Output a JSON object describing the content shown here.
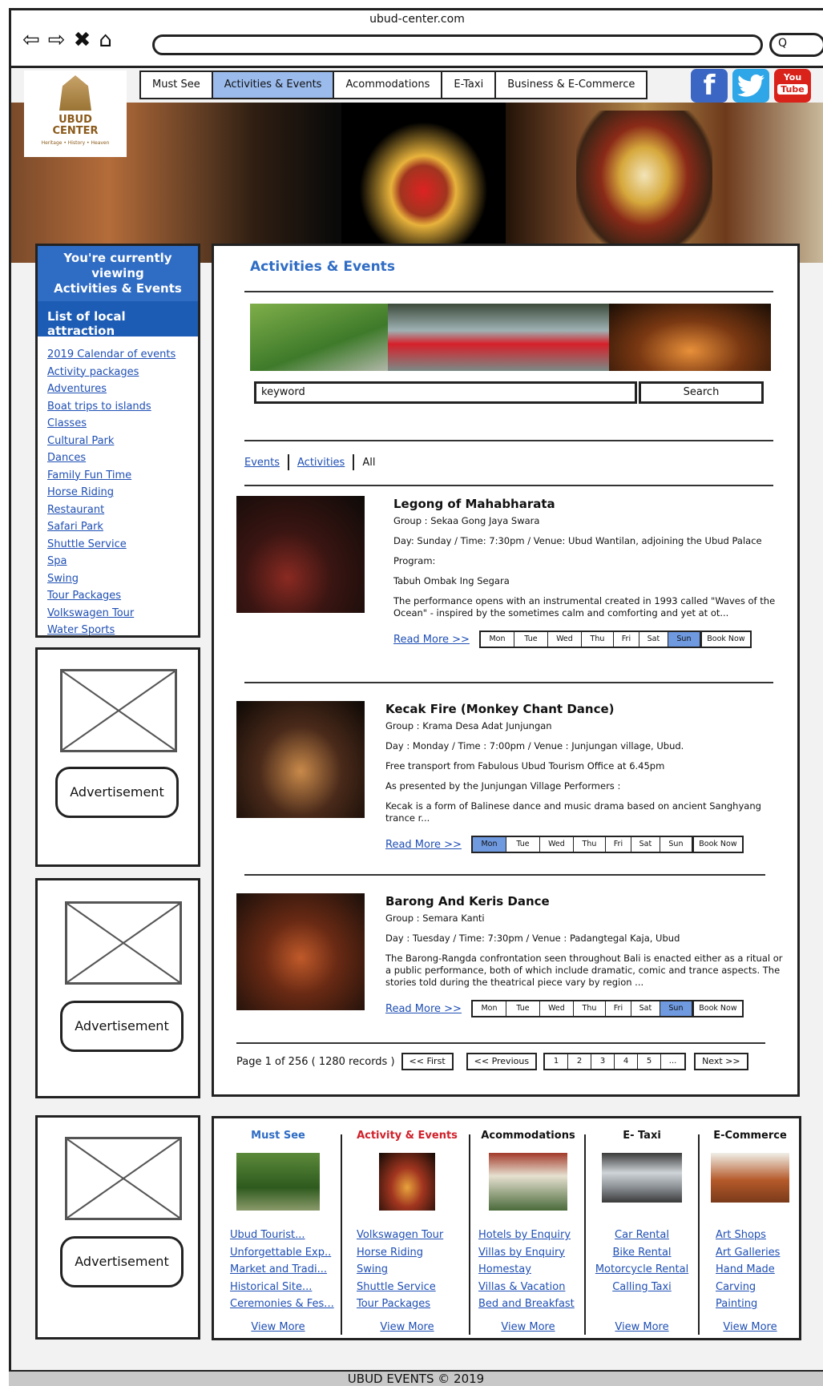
{
  "browser": {
    "url": "ubud-center.com",
    "nav_symbols": [
      "⇦",
      "⇨",
      "✖",
      "⌂"
    ],
    "search_symbol": "Q"
  },
  "logo": {
    "line1": "UBUD",
    "line2": "CENTER",
    "tagline": "Heritage • History • Heaven"
  },
  "topnav": {
    "items": [
      "Must See",
      "Activities & Events",
      "Acommodations",
      "E-Taxi",
      "Business & E-Commerce"
    ],
    "active": "Activities & Events"
  },
  "social": {
    "facebook": "f",
    "youtube_line1": "You",
    "youtube_line2": "Tube"
  },
  "sidebar": {
    "viewing_line1": "You're currently viewing",
    "viewing_line2": "Activities & Events",
    "title": "List of local attraction",
    "links": [
      "2019 Calendar of events",
      "Activity packages",
      "Adventures",
      "Boat trips to islands",
      "Classes",
      "Cultural Park",
      "Dances",
      "Family Fun Time",
      "Horse Riding",
      "Restaurant",
      "Safari Park",
      "Shuttle Service",
      "Spa",
      "Swing",
      "Tour Packages",
      "Volkswagen Tour",
      "Water Sports"
    ]
  },
  "ads": {
    "label": "Advertisement"
  },
  "main": {
    "title": "Activities & Events",
    "search": {
      "value": "keyword",
      "button": "Search"
    },
    "filter": {
      "events": "Events",
      "activities": "Activities",
      "all": "All"
    },
    "days": [
      "Mon",
      "Tue",
      "Wed",
      "Thu",
      "Fri",
      "Sat",
      "Sun"
    ],
    "book_now": "Book Now",
    "read_more": "Read More >>",
    "events": [
      {
        "title": "Legong of Mahabharata",
        "group": "Group : Sekaa Gong Jaya Swara",
        "day": "Day: Sunday / Time: 7:30pm / Venue: Ubud Wantilan, adjoining the Ubud Palace",
        "program_label": "Program:",
        "program": "Tabuh Ombak Ing Segara",
        "desc": "The performance opens with an instrumental created in 1993 called \"Waves of the Ocean\"  - inspired by the sometimes calm and comforting and yet at ot...",
        "active_day": "Sun"
      },
      {
        "title": "Kecak Fire (Monkey Chant Dance)",
        "group": "Group : Krama Desa Adat Junjungan",
        "day": "Day : Monday / Time : 7:00pm / Venue : Junjungan village, Ubud.",
        "transport": "Free transport from Fabulous Ubud Tourism Office at 6.45pm",
        "presented": "As presented by the Junjungan Village Performers :",
        "desc": "Kecak is a form of Balinese dance and music drama based on ancient Sanghyang trance r...",
        "active_day": "Mon"
      },
      {
        "title": "Barong And Keris Dance",
        "group": "Group : Semara Kanti",
        "day": "Day : Tuesday / Time: 7:30pm / Venue : Padangtegal Kaja, Ubud",
        "desc": "The Barong-Rangda confrontation seen throughout Bali is enacted either as a ritual or a public performance, both of which include dramatic, comic and trance aspects. The stories told during the theatrical piece vary by region ...",
        "active_day": "Sun"
      }
    ],
    "pager": {
      "info": "Page 1 of 256 ( 1280 records )",
      "first": "<< First",
      "prev": "<< Previous",
      "pages": [
        "1",
        "2",
        "3",
        "4",
        "5",
        "..."
      ],
      "next": "Next >>"
    }
  },
  "footer_cols": [
    {
      "heading": "Must See",
      "links": [
        "Ubud Tourist...",
        "Unforgettable Exp..",
        "Market and Tradi...",
        "Historical Site...",
        "Ceremonies & Fes..."
      ],
      "view_more": "View More"
    },
    {
      "heading": "Activity & Events",
      "links": [
        "Volkswagen Tour",
        "Horse Riding",
        "Swing",
        "Shuttle Service",
        "Tour Packages"
      ],
      "view_more": "View More"
    },
    {
      "heading": "Acommodations",
      "links": [
        "Hotels by Enquiry",
        "Villas by Enquiry",
        "Homestay",
        "Villas & Vacation",
        "Bed and Breakfast"
      ],
      "view_more": "View More"
    },
    {
      "heading": "E- Taxi",
      "links": [
        "Car Rental",
        "Bike Rental",
        "Motorcycle Rental",
        "Calling Taxi"
      ],
      "view_more": "View More"
    },
    {
      "heading": "E-Commerce",
      "links": [
        "Art Shops",
        "Art Galleries",
        "Hand Made",
        "Carving",
        "Painting"
      ],
      "view_more": "View More"
    }
  ],
  "copyright": "UBUD EVENTS © 2019",
  "colors": {
    "accent": "#2f6cc4",
    "active_tab": "#9bbbec",
    "link": "#1f4fb4",
    "red_heading": "#d0202a"
  }
}
